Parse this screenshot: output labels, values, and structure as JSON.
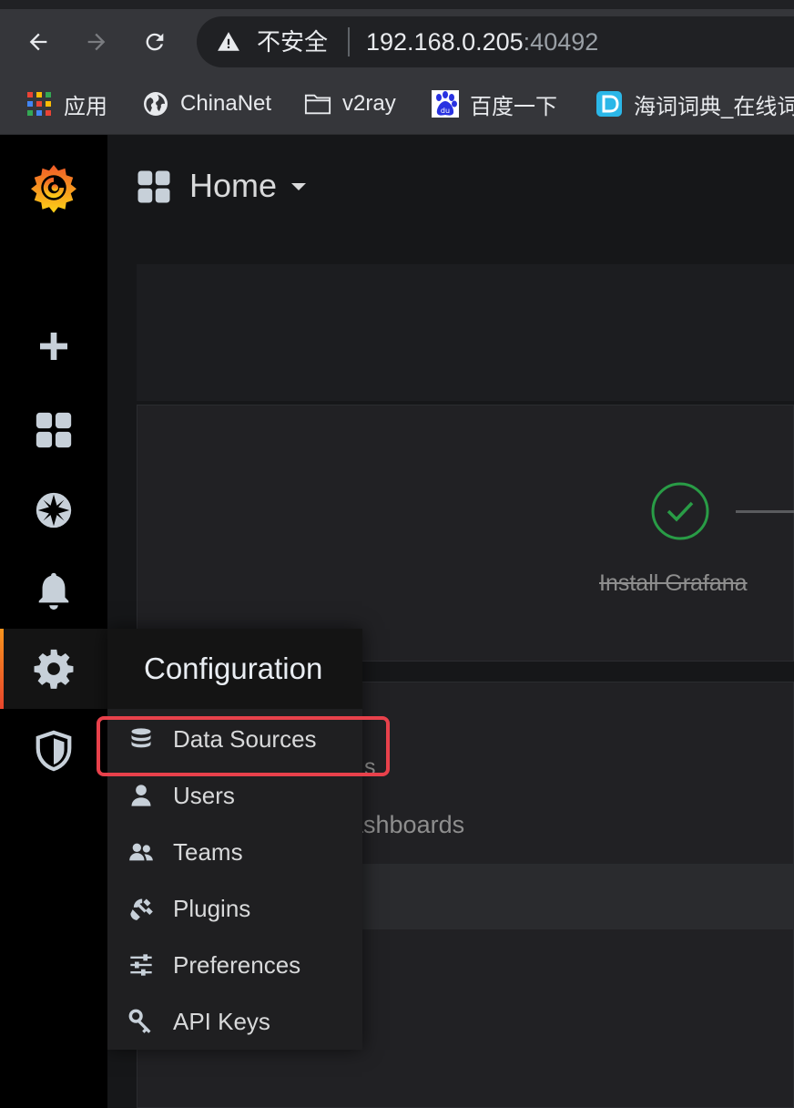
{
  "browser": {
    "nav": {
      "back_icon": "arrow-left-icon",
      "forward_icon": "arrow-right-icon",
      "reload_icon": "reload-icon"
    },
    "omnibox": {
      "security_label": "不安全",
      "url_host": "192.168.0.205",
      "url_port": ":40492"
    },
    "bookmarks": [
      {
        "label": "应用",
        "icon": "apps-grid-icon"
      },
      {
        "label": "ChinaNet",
        "icon": "globe-icon"
      },
      {
        "label": "v2ray",
        "icon": "folder-icon"
      },
      {
        "label": "百度一下",
        "icon": "baidu-paw-icon"
      },
      {
        "label": "海词词典_在线词",
        "icon": "dict-d-icon"
      }
    ]
  },
  "grafana": {
    "sidemenu": [
      {
        "icon": "grafana-logo-icon"
      },
      {
        "icon": "plus-icon"
      },
      {
        "icon": "dashboards-grid-icon"
      },
      {
        "icon": "explore-compass-icon"
      },
      {
        "icon": "alerting-bell-icon"
      },
      {
        "icon": "configuration-gear-icon",
        "active": true
      },
      {
        "icon": "server-admin-shield-icon"
      }
    ],
    "header": {
      "title": "Home"
    },
    "getting_started": {
      "step_label": "Install Grafana",
      "step_status": "complete"
    },
    "partial_text": {
      "suffix_s": "s",
      "dashboards_fragment": "ashboards"
    },
    "config_menu": {
      "title": "Configuration",
      "items": [
        {
          "label": "Data Sources",
          "icon": "database-icon",
          "highlighted": true
        },
        {
          "label": "Users",
          "icon": "user-icon"
        },
        {
          "label": "Teams",
          "icon": "users-icon"
        },
        {
          "label": "Plugins",
          "icon": "plug-icon"
        },
        {
          "label": "Preferences",
          "icon": "sliders-icon"
        },
        {
          "label": "API Keys",
          "icon": "key-icon"
        }
      ]
    },
    "colors": {
      "accent_orange": "#f7941d",
      "success_green": "#299c46",
      "highlight_red": "#e8414b"
    }
  }
}
